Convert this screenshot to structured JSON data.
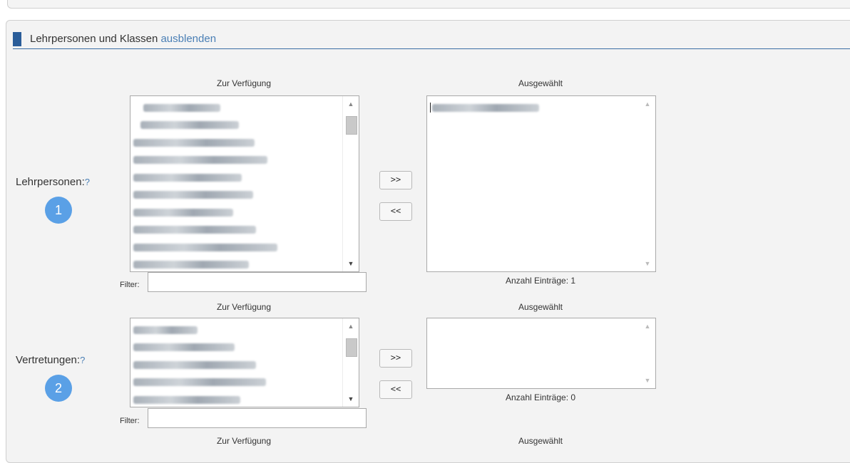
{
  "section": {
    "title": "Lehrpersonen und Klassen",
    "toggle_link": "ausblenden"
  },
  "lehrpersonen": {
    "label": "Lehrpersonen:",
    "help": "?",
    "badge": "1",
    "available_header": "Zur Verfügung",
    "selected_header": "Ausgewählt",
    "add_button": ">>",
    "remove_button": "<<",
    "filter_label": "Filter:",
    "filter_value": "",
    "count_text": "Anzahl Einträge: 1"
  },
  "vertretungen": {
    "label": "Vertretungen:",
    "help": "?",
    "badge": "2",
    "available_header": "Zur Verfügung",
    "selected_header": "Ausgewählt",
    "add_button": ">>",
    "remove_button": "<<",
    "filter_label": "Filter:",
    "filter_value": "",
    "count_text": "Anzahl Einträge: 0"
  },
  "next_block": {
    "available_header": "Zur Verfügung",
    "selected_header": "Ausgewählt"
  },
  "colors": {
    "accent": "#2a5d99",
    "link": "#4a7fb5",
    "badge": "#5aa0e6"
  },
  "icons": [
    "scroll-up-arrow-icon",
    "scroll-down-arrow-icon"
  ]
}
